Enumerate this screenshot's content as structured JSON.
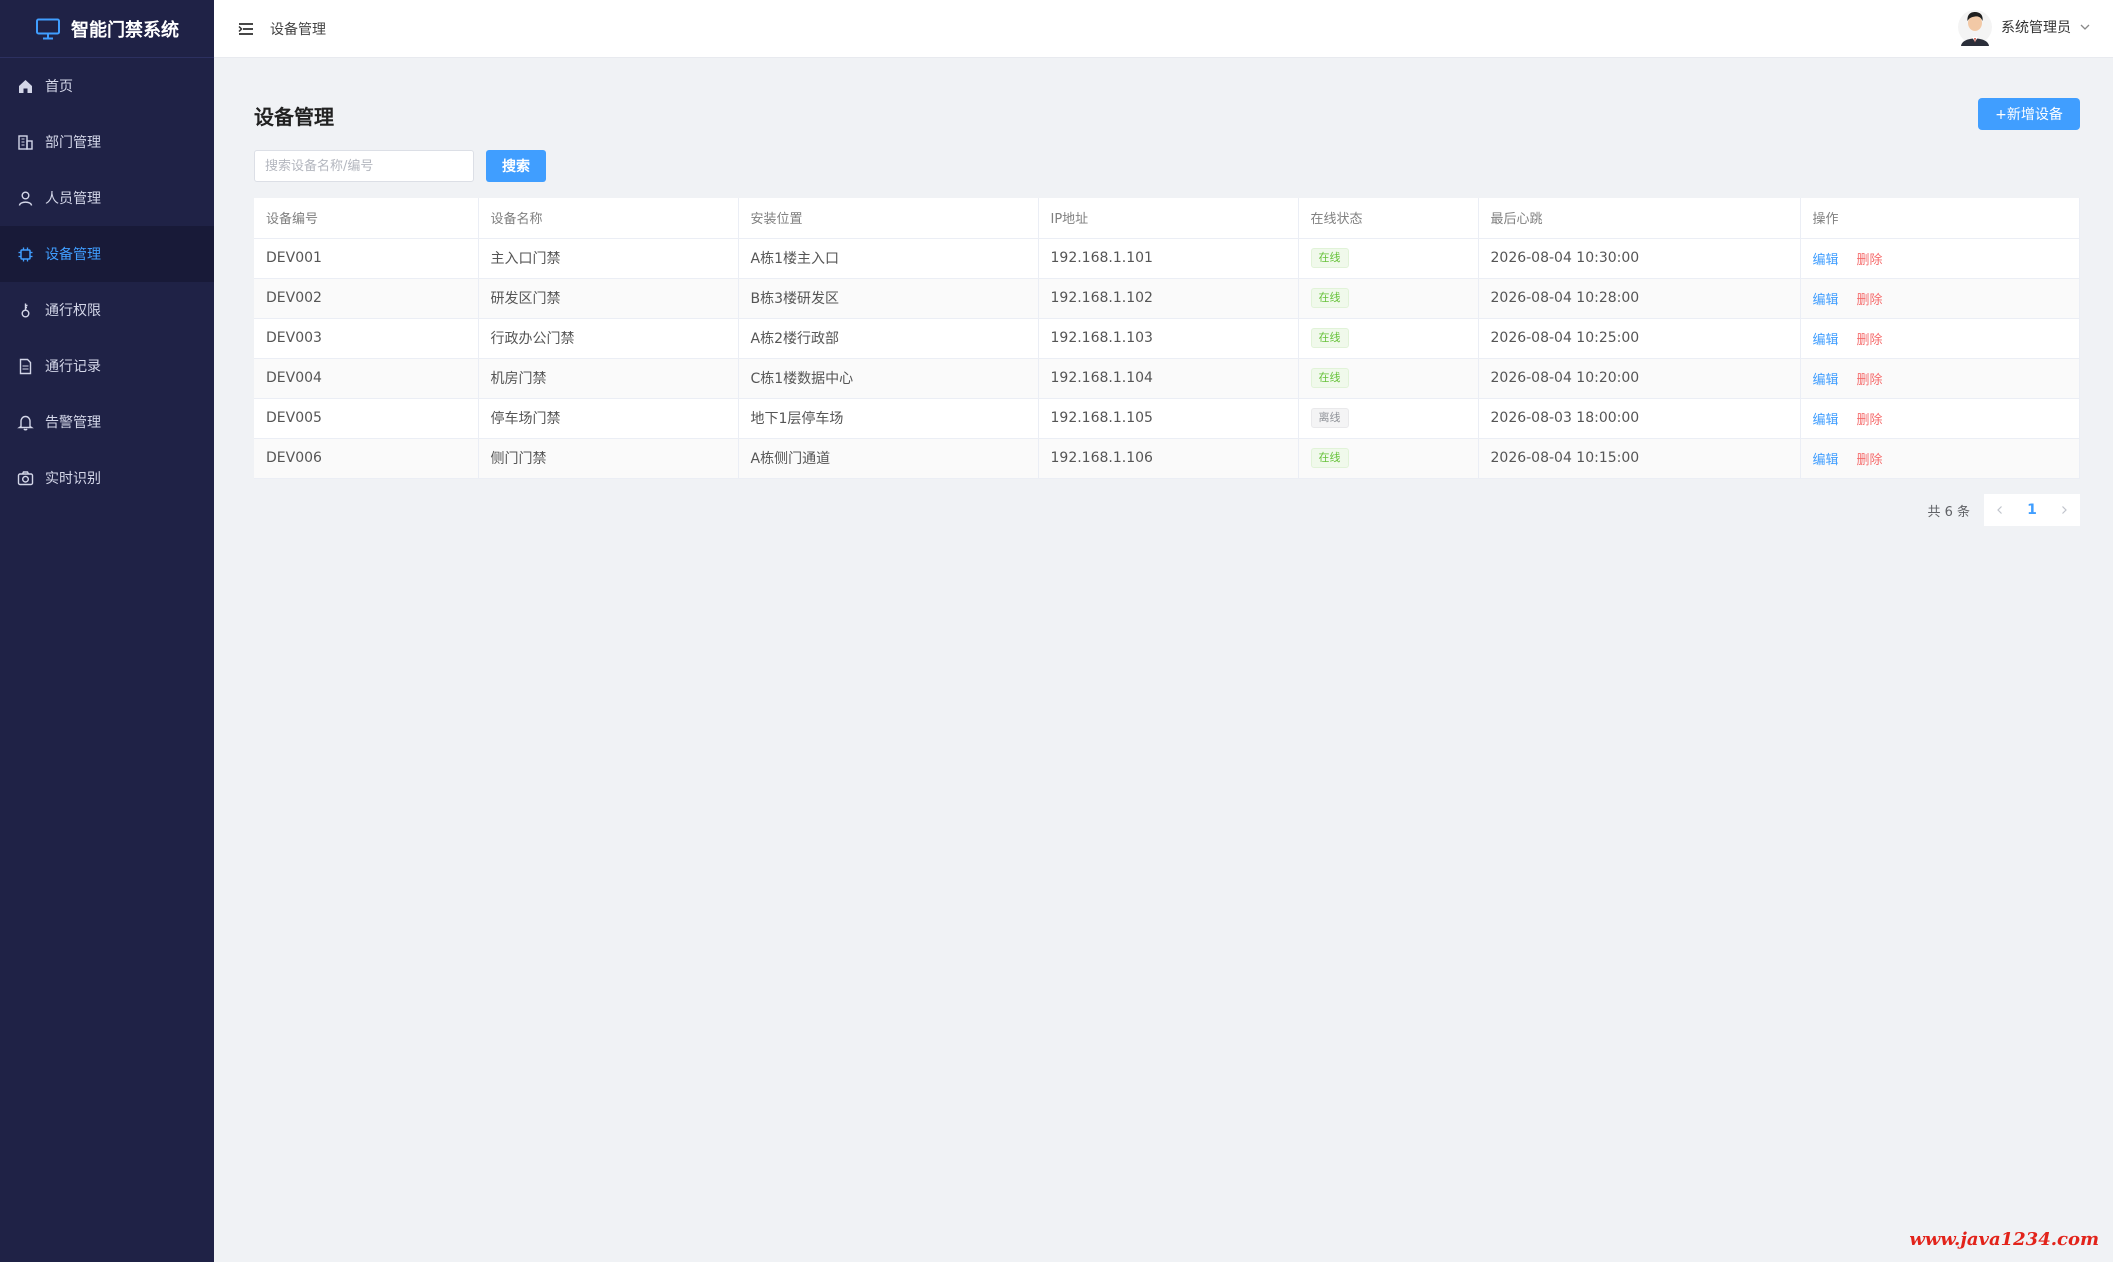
{
  "app": {
    "title": "智能门禁系统"
  },
  "sidebar": {
    "items": [
      {
        "label": "首页",
        "icon": "home-icon",
        "active": false
      },
      {
        "label": "部门管理",
        "icon": "building-icon",
        "active": false
      },
      {
        "label": "人员管理",
        "icon": "user-icon",
        "active": false
      },
      {
        "label": "设备管理",
        "icon": "chip-icon",
        "active": true
      },
      {
        "label": "通行权限",
        "icon": "key-icon",
        "active": false
      },
      {
        "label": "通行记录",
        "icon": "document-icon",
        "active": false
      },
      {
        "label": "告警管理",
        "icon": "bell-icon",
        "active": false
      },
      {
        "label": "实时识别",
        "icon": "camera-icon",
        "active": false
      }
    ]
  },
  "header": {
    "breadcrumb": "设备管理",
    "user_name": "系统管理员"
  },
  "page": {
    "title": "设备管理",
    "add_button": "+新增设备",
    "search_placeholder": "搜索设备名称/编号",
    "search_value": "",
    "search_button": "搜索"
  },
  "table": {
    "columns": [
      "设备编号",
      "设备名称",
      "安装位置",
      "IP地址",
      "在线状态",
      "最后心跳",
      "操作"
    ],
    "rows": [
      {
        "id": "DEV001",
        "name": "主入口门禁",
        "location": "A栋1楼主入口",
        "ip": "192.168.1.101",
        "status": "在线",
        "heartbeat": "2026-08-04 10:30:00"
      },
      {
        "id": "DEV002",
        "name": "研发区门禁",
        "location": "B栋3楼研发区",
        "ip": "192.168.1.102",
        "status": "在线",
        "heartbeat": "2026-08-04 10:28:00"
      },
      {
        "id": "DEV003",
        "name": "行政办公门禁",
        "location": "A栋2楼行政部",
        "ip": "192.168.1.103",
        "status": "在线",
        "heartbeat": "2026-08-04 10:25:00"
      },
      {
        "id": "DEV004",
        "name": "机房门禁",
        "location": "C栋1楼数据中心",
        "ip": "192.168.1.104",
        "status": "在线",
        "heartbeat": "2026-08-04 10:20:00"
      },
      {
        "id": "DEV005",
        "name": "停车场门禁",
        "location": "地下1层停车场",
        "ip": "192.168.1.105",
        "status": "离线",
        "heartbeat": "2026-08-03 18:00:00"
      },
      {
        "id": "DEV006",
        "name": "侧门门禁",
        "location": "A栋侧门通道",
        "ip": "192.168.1.106",
        "status": "在线",
        "heartbeat": "2026-08-04 10:15:00"
      }
    ],
    "actions": {
      "edit": "编辑",
      "delete": "删除"
    }
  },
  "pagination": {
    "total_text": "共 6 条",
    "current_page": "1"
  },
  "watermark": "www.java1234.com",
  "colors": {
    "sidebar_bg": "#1f2246",
    "accent": "#409eff",
    "danger": "#f56c6c",
    "online": "#67c23a"
  }
}
